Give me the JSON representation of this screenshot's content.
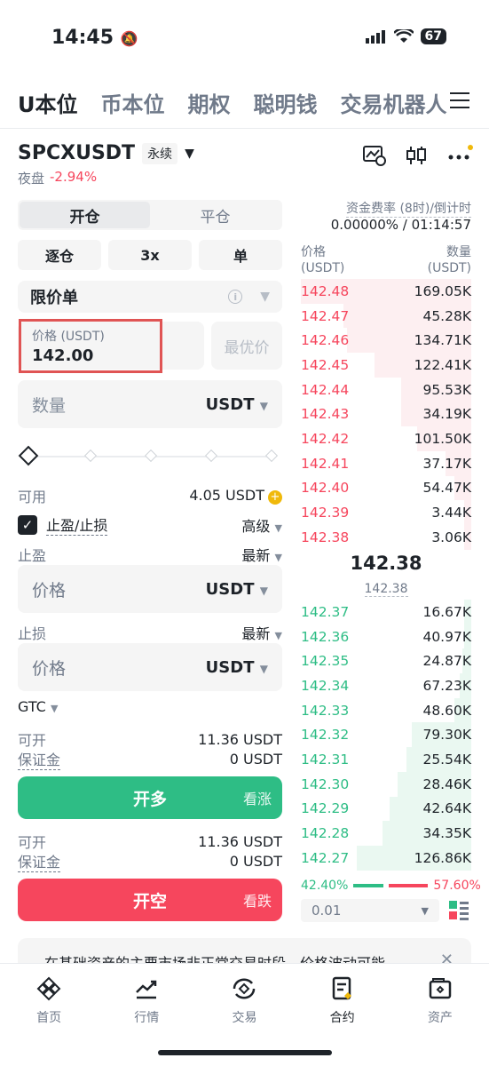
{
  "status": {
    "time": "14:45",
    "battery": "67"
  },
  "top_tabs": [
    "U本位",
    "币本位",
    "期权",
    "聪明钱",
    "交易机器人"
  ],
  "symbol": {
    "name": "SPCXUSDT",
    "badge": "永续",
    "session": "夜盘",
    "change": "-2.94%"
  },
  "left": {
    "side_tabs": [
      "开仓",
      "平仓"
    ],
    "mode": "逐仓",
    "leverage": "3x",
    "position_mode": "单",
    "order_type": "限价单",
    "price_label": "价格 (USDT)",
    "price_value": "142.00",
    "best_price": "最优价",
    "qty_placeholder": "数量",
    "unit": "USDT",
    "available_label": "可用",
    "available_value": "4.05 USDT",
    "tpsl_label": "止盈/止损",
    "advanced": "高级",
    "tp_label": "止盈",
    "sl_label": "止损",
    "latest": "最新",
    "price_placeholder": "价格",
    "tif": "GTC",
    "can_open_label": "可开",
    "can_open_value": "11.36 USDT",
    "margin_label": "保证金",
    "margin_value": "0 USDT",
    "buy_label": "开多",
    "buy_aux": "看涨",
    "sell_label": "开空",
    "sell_aux": "看跌"
  },
  "orderbook": {
    "funding_label": "资金费率 (8时)/倒计时",
    "funding_value": "0.00000% / 01:14:57",
    "price_header": [
      "价格",
      "(USDT)"
    ],
    "qty_header": [
      "数量",
      "(USDT)"
    ],
    "asks": [
      {
        "price": "142.48",
        "qty": "169.05K",
        "depth": 1.0
      },
      {
        "price": "142.47",
        "qty": "45.28K",
        "depth": 0.75
      },
      {
        "price": "142.46",
        "qty": "134.71K",
        "depth": 0.73
      },
      {
        "price": "142.45",
        "qty": "122.41K",
        "depth": 0.57
      },
      {
        "price": "142.44",
        "qty": "95.53K",
        "depth": 0.41
      },
      {
        "price": "142.43",
        "qty": "34.19K",
        "depth": 0.41
      },
      {
        "price": "142.42",
        "qty": "101.50K",
        "depth": 0.32
      },
      {
        "price": "142.41",
        "qty": "37.17K",
        "depth": 0.15
      },
      {
        "price": "142.40",
        "qty": "54.47K",
        "depth": 0.1
      },
      {
        "price": "142.39",
        "qty": "3.44K",
        "depth": 0.04
      },
      {
        "price": "142.38",
        "qty": "3.06K",
        "depth": 0.04
      }
    ],
    "last_price": "142.38",
    "mark_price": "142.38",
    "bids": [
      {
        "price": "142.37",
        "qty": "16.67K",
        "depth": 0.04
      },
      {
        "price": "142.36",
        "qty": "40.97K",
        "depth": 0.04
      },
      {
        "price": "142.35",
        "qty": "24.87K",
        "depth": 0.05
      },
      {
        "price": "142.34",
        "qty": "67.23K",
        "depth": 0.07
      },
      {
        "price": "142.33",
        "qty": "48.60K",
        "depth": 0.1
      },
      {
        "price": "142.32",
        "qty": "79.30K",
        "depth": 0.35
      },
      {
        "price": "142.31",
        "qty": "25.54K",
        "depth": 0.38
      },
      {
        "price": "142.30",
        "qty": "28.46K",
        "depth": 0.43
      },
      {
        "price": "142.29",
        "qty": "42.64K",
        "depth": 0.48
      },
      {
        "price": "142.28",
        "qty": "34.35K",
        "depth": 0.52
      },
      {
        "price": "142.27",
        "qty": "126.86K",
        "depth": 0.67
      }
    ],
    "buy_ratio": "42.40%",
    "sell_ratio": "57.60%",
    "precision": "0.01"
  },
  "notice": "在基础资产的主要市场非正常交易时段，价格波动可能",
  "nav": [
    "首页",
    "行情",
    "交易",
    "合约",
    "资产"
  ],
  "colors": {
    "green": "#2ebd85",
    "red": "#f6465d",
    "accent": "#f0b90b"
  }
}
